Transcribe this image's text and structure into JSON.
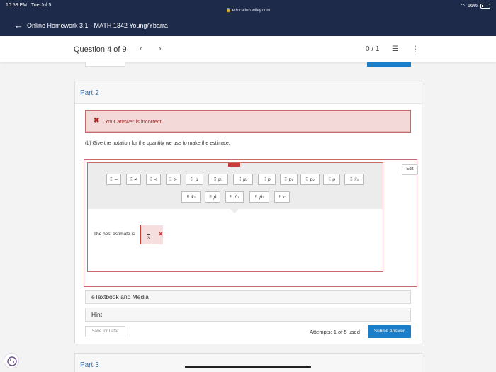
{
  "status_bar": {
    "time": "10:58 PM",
    "date": "Tue Jul 5",
    "url": "education.wiley.com",
    "battery": "16%"
  },
  "header": {
    "title": "Online Homework 3.1 - MATH 1342 Young/Ybarra"
  },
  "question_nav": {
    "label": "Question 4 of 9",
    "score": "0 / 1"
  },
  "part": {
    "title": "Part 2",
    "alert": "Your answer is incorrect.",
    "prompt": "(b) Give the notation for the quantity we use to make the estimate.",
    "edit_label": "Edit",
    "palette_row1": [
      "=",
      "≠",
      "<",
      ">",
      "μ",
      "μ₁",
      "μ₂",
      "p",
      "p₁",
      "p₂",
      "ρ",
      "x̄₁"
    ],
    "palette_row2": [
      "x̄₂",
      "p̂",
      "p̂₁",
      "p̂₂",
      "r"
    ],
    "answer_label": "The best estimate is",
    "answer_value": "x",
    "accordions": [
      "eTextbook and Media",
      "Hint"
    ],
    "save_later": "Save for Later",
    "attempts": "Attempts: 1 of 5 used",
    "submit": "Submit Answer"
  },
  "next_part": {
    "title": "Part 3"
  },
  "colors": {
    "navy": "#1e2a4a",
    "accent_blue": "#1a7ec8",
    "error_red": "#c93a3a"
  }
}
